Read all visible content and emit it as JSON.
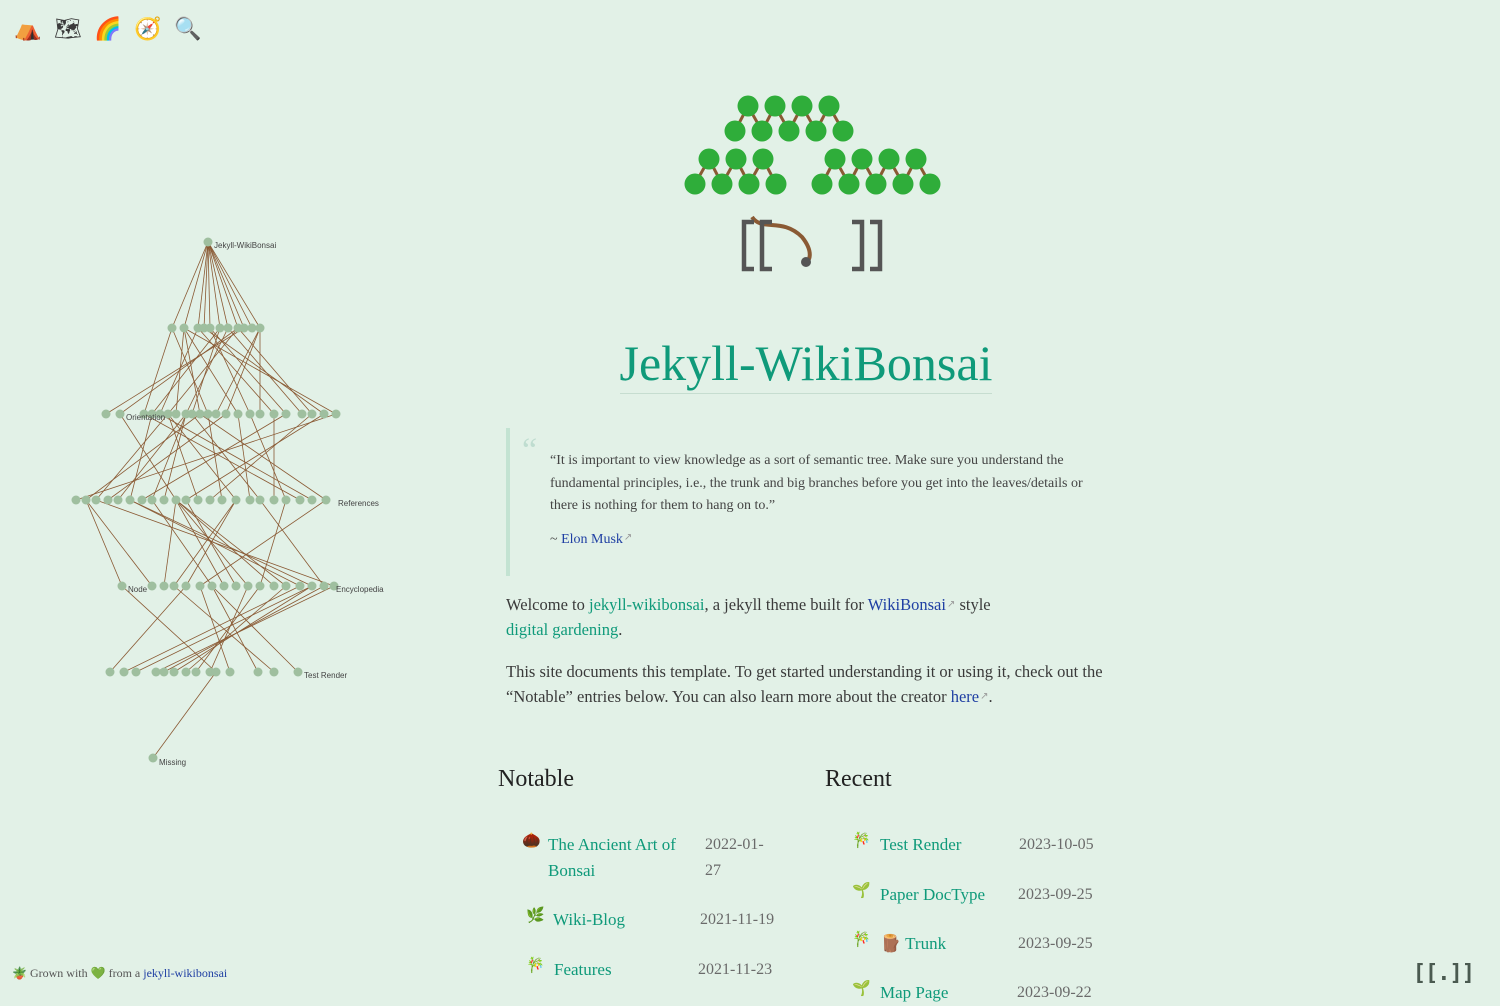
{
  "nav": {
    "icons": [
      {
        "name": "tent-icon",
        "glyph": "⛺"
      },
      {
        "name": "map-icon",
        "glyph": "🗺"
      },
      {
        "name": "rainbow-icon",
        "glyph": "🌈"
      },
      {
        "name": "compass-icon",
        "glyph": "🧭"
      },
      {
        "name": "search-icon",
        "glyph": "🔍"
      }
    ]
  },
  "graph": {
    "labels": [
      "Jekyll-WikiBonsai",
      "Missing",
      "Node",
      "Test Render",
      "Orientation",
      "References",
      "Encyclopedia"
    ]
  },
  "main": {
    "title": "Jekyll-WikiBonsai",
    "quote": {
      "text": "“It is important to view knowledge as a sort of semantic tree. Make sure you understand the fundamental principles, i.e., the trunk and big branches before you get into the leaves/details or there is nothing for them to hang on to.”",
      "attr_prefix": "~ ",
      "attr_link": "Elon Musk",
      "ext": "↗"
    },
    "welcome": {
      "t1": "Welcome to ",
      "link1": "jekyll-wikibonsai",
      "t2": ", a jekyll theme built for ",
      "link2": "WikiBonsai",
      "t3": " style ",
      "link3": "digital gardening",
      "t4": "."
    },
    "site_doc": {
      "text": "This site documents this template. To get started understanding it or using it, check out the “Notable” entries below. You can also learn more about the creator ",
      "link": "here",
      "end": "."
    }
  },
  "notable": {
    "heading": "Notable",
    "items": [
      {
        "icon": "🌰",
        "title": "The Ancient Art of",
        "title2": "Bonsai",
        "date": "2022-01-",
        "date2": "27"
      },
      {
        "icon": "🌿",
        "title": "Wiki-Blog",
        "date": "2021-11-19"
      },
      {
        "icon": "🎋",
        "title": "Features",
        "date": "2021-11-23"
      }
    ]
  },
  "recent": {
    "heading": "Recent",
    "items": [
      {
        "icon": "🎋",
        "title": "Test Render",
        "date": "2023-10-05"
      },
      {
        "icon": "🌱",
        "title": "Paper DocType",
        "date": "2023-09-25"
      },
      {
        "icon": "🎋",
        "title_icon": "🪵",
        "title": "Trunk",
        "date": "2023-09-25"
      },
      {
        "icon": "🌱",
        "title": "Map Page",
        "date": "2023-09-22"
      }
    ]
  },
  "footer": {
    "plant": "🪴",
    "text1": " Grown with ",
    "heart": "💚",
    "text2": " from a ",
    "link": "jekyll-wikibonsai"
  },
  "corner_logo": "[[.]]",
  "colors": {
    "accent": "#0f9a7a",
    "link": "#1f3fa3",
    "background": "#e2f1e7",
    "leaf": "#2fad3a",
    "trunk": "#8a5a34"
  }
}
